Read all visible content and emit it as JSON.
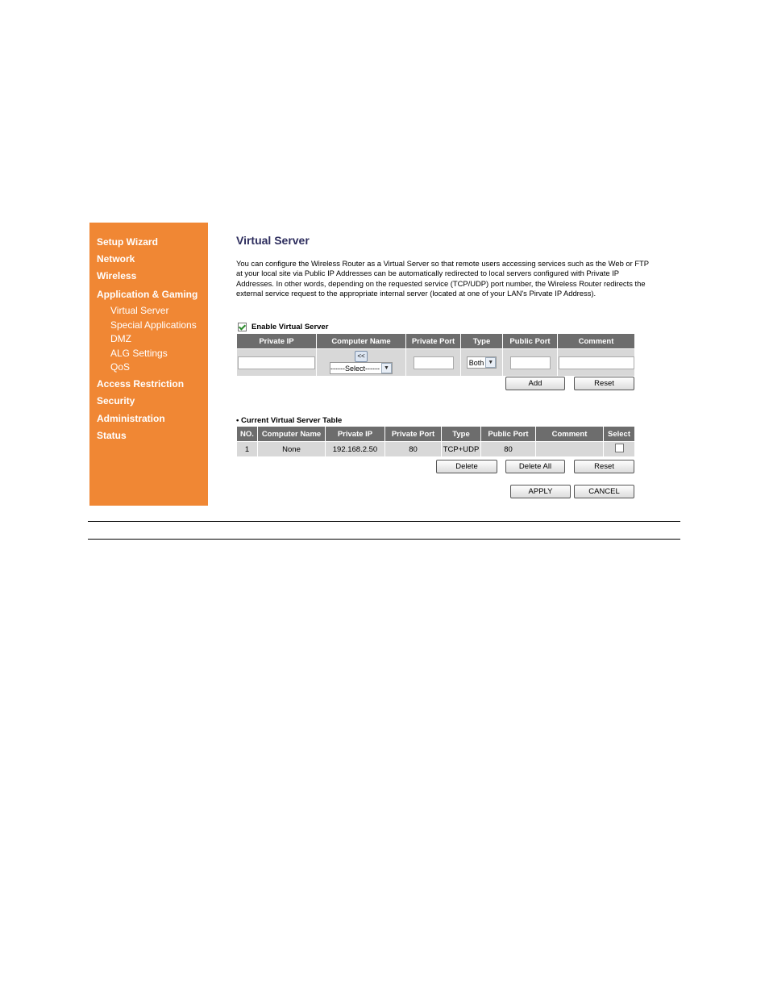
{
  "sidebar": {
    "items": [
      {
        "label": "Setup Wizard"
      },
      {
        "label": "Network"
      },
      {
        "label": "Wireless"
      },
      {
        "label": "Application & Gaming"
      },
      {
        "label": "Access Restriction"
      },
      {
        "label": "Security"
      },
      {
        "label": "Administration"
      },
      {
        "label": "Status"
      }
    ],
    "subitems": [
      {
        "label": "Virtual Server"
      },
      {
        "label": "Special Applications"
      },
      {
        "label": "DMZ"
      },
      {
        "label": "ALG Settings"
      },
      {
        "label": "QoS"
      }
    ]
  },
  "page": {
    "title": "Virtual Server",
    "description": "You can configure the Wireless Router as a Virtual Server so that remote users accessing services such as the Web or FTP at your local site via Public IP Addresses can be automatically redirected to local servers configured with Private IP Addresses. In other words, depending on the requested service (TCP/UDP) port number, the Wireless Router redirects the external service request to the appropriate internal server (located at one of your LAN's Pirvate IP Address).",
    "enable_label": "Enable Virtual Server",
    "enable_checked": true
  },
  "entry_table": {
    "headers": [
      "Private IP",
      "Computer Name",
      "Private Port",
      "Type",
      "Public Port",
      "Comment"
    ],
    "copy_button": "<<",
    "computer_select": "------Select------",
    "type_select": "Both",
    "private_ip": "",
    "private_port": "",
    "public_port": "",
    "comment": "",
    "add_label": "Add",
    "reset_label": "Reset"
  },
  "current_table": {
    "title": "Current Virtual Server Table",
    "headers": [
      "NO.",
      "Computer Name",
      "Private IP",
      "Private Port",
      "Type",
      "Public Port",
      "Comment",
      "Select"
    ],
    "rows": [
      {
        "no": "1",
        "computer_name": "None",
        "private_ip": "192.168.2.50",
        "private_port": "80",
        "type": "TCP+UDP",
        "public_port": "80",
        "comment": "",
        "selected": false
      }
    ],
    "delete_label": "Delete",
    "delete_all_label": "Delete All",
    "reset_label": "Reset"
  },
  "footer": {
    "apply_label": "APPLY",
    "cancel_label": "CANCEL"
  }
}
